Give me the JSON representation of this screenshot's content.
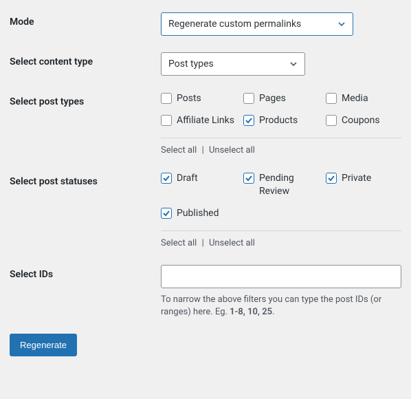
{
  "mode": {
    "label": "Mode",
    "value": "Regenerate custom permalinks"
  },
  "content_type": {
    "label": "Select content type",
    "value": "Post types"
  },
  "post_types": {
    "label": "Select post types",
    "options": [
      {
        "label": "Posts",
        "checked": false
      },
      {
        "label": "Pages",
        "checked": false
      },
      {
        "label": "Media",
        "checked": false
      },
      {
        "label": "Affiliate Links",
        "checked": false
      },
      {
        "label": "Products",
        "checked": true
      },
      {
        "label": "Coupons",
        "checked": false
      }
    ],
    "select_all": "Select all",
    "unselect_all": "Unselect all"
  },
  "post_statuses": {
    "label": "Select post statuses",
    "options": [
      {
        "label": "Draft",
        "checked": true
      },
      {
        "label": "Pending Review",
        "checked": true
      },
      {
        "label": "Private",
        "checked": true
      },
      {
        "label": "Published",
        "checked": true
      }
    ],
    "select_all": "Select all",
    "unselect_all": "Unselect all"
  },
  "ids": {
    "label": "Select IDs",
    "value": "",
    "help_pre": "To narrow the above filters you can type the post IDs (or ranges) here. Eg. ",
    "help_bold": "1-8, 10, 25",
    "help_post": "."
  },
  "actions": {
    "regenerate": "Regenerate"
  },
  "sep": " | "
}
